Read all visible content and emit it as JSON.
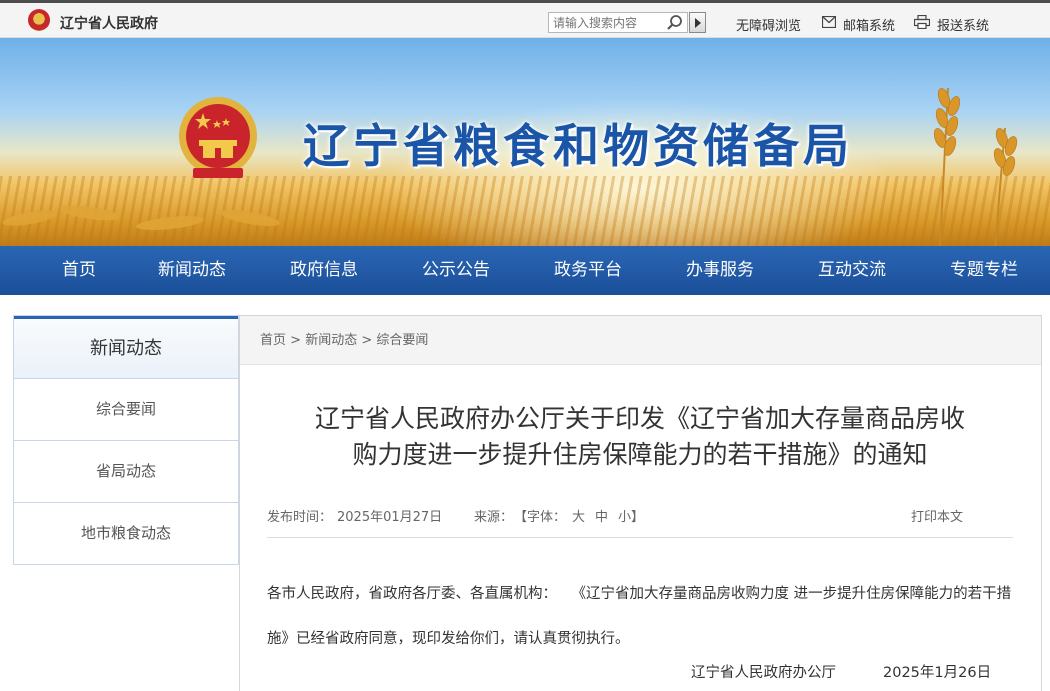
{
  "topbar": {
    "gov_name": "辽宁省人民政府",
    "search_placeholder": "请输入搜索内容",
    "links": {
      "accessibility": "无障碍浏览",
      "mail": "邮箱系统",
      "report": "报送系统"
    }
  },
  "banner": {
    "site_title": "辽宁省粮食和物资储备局"
  },
  "nav": {
    "items": [
      "首页",
      "新闻动态",
      "政府信息",
      "公示公告",
      "政务平台",
      "办事服务",
      "互动交流",
      "专题专栏"
    ]
  },
  "sidebar": {
    "title": "新闻动态",
    "items": [
      "综合要闻",
      "省局动态",
      "地市粮食动态"
    ]
  },
  "breadcrumb": {
    "items": [
      "首页",
      "新闻动态",
      "综合要闻"
    ],
    "separator": ">"
  },
  "article": {
    "title_line1": "辽宁省人民政府办公厅关于印发《辽宁省加大存量商品房收",
    "title_line2": "购力度进一步提升住房保障能力的若干措施》的通知",
    "meta": {
      "publish_label": "发布时间：",
      "publish_date": "2025年01月27日",
      "source_label": "来源：",
      "font_open": "【字体：",
      "font_large": "大",
      "font_medium": "中",
      "font_small": "小",
      "font_close": "】",
      "print": "打印本文"
    },
    "body": "各市人民政府，省政府各厅委、各直属机构：　　《辽宁省加大存量商品房收购力度 进一步提升住房保障能力的若干措施》已经省政府同意，现印发给你们，请认真贯彻执行。",
    "signature_org": "辽宁省人民政府办公厅",
    "signature_date": "2025年1月26日"
  },
  "colors": {
    "nav_blue": "#1f57a3",
    "title_blue": "#1a55a8",
    "sidebar_accent": "#2b65b1"
  },
  "icons": [
    "national-emblem-icon",
    "search-icon",
    "mail-icon",
    "printer-icon",
    "play-arrow-icon"
  ]
}
